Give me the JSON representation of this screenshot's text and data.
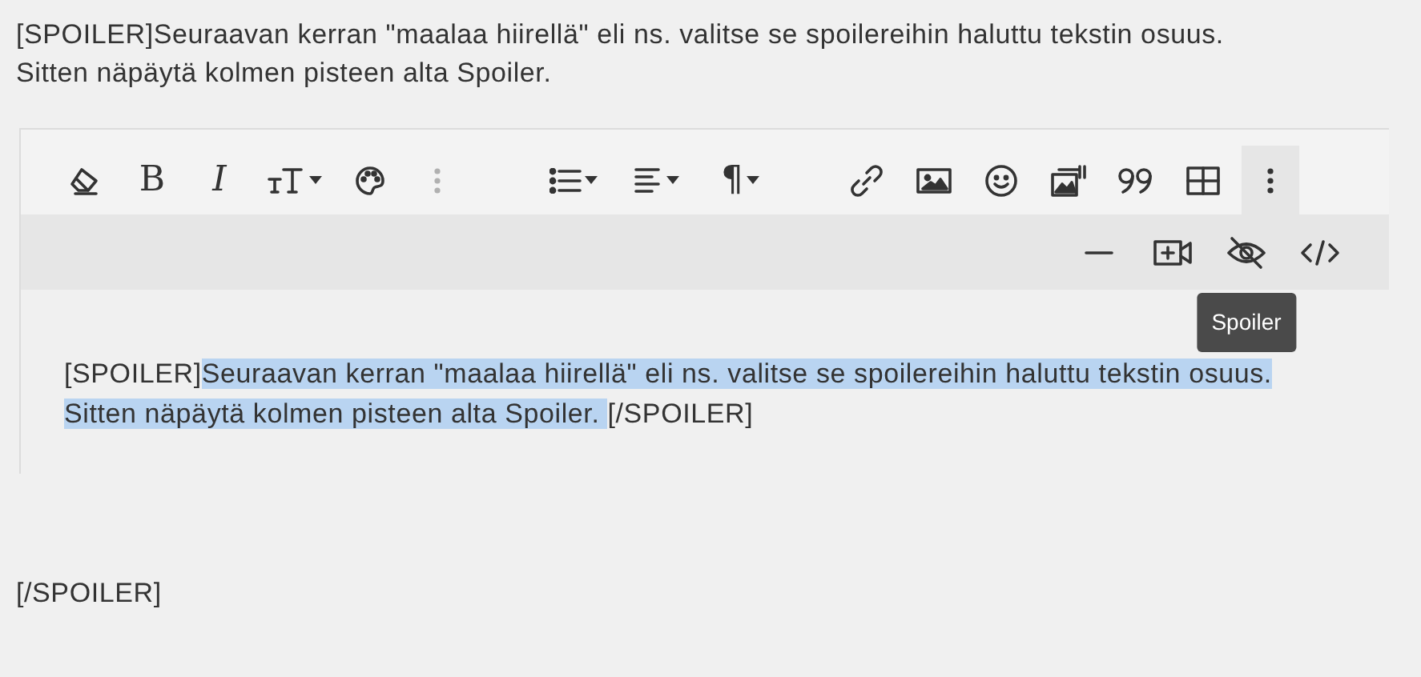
{
  "intro": {
    "lines": [
      "[SPOILER]Seuraavan kerran \"maalaa hiirellä\" eli ns. valitse se spoilereihin haluttu tekstin osuus.",
      "Sitten näpäytä kolmen pisteen alta Spoiler."
    ]
  },
  "editor": {
    "toolbar": {
      "groups": [
        {
          "buttons": [
            {
              "kind": "eraser",
              "caret": false,
              "active": false,
              "disabled": false
            },
            {
              "kind": "bold",
              "glyph": "B",
              "caret": false,
              "active": false,
              "disabled": false
            },
            {
              "kind": "italic",
              "glyph": "I",
              "caret": false,
              "active": false,
              "disabled": false
            },
            {
              "kind": "text-size",
              "caret": true,
              "active": false,
              "disabled": false
            },
            {
              "kind": "palette",
              "caret": false,
              "active": false,
              "disabled": false
            },
            {
              "kind": "dots",
              "caret": false,
              "active": false,
              "disabled": true
            }
          ]
        },
        {
          "buttons": [
            {
              "kind": "list",
              "caret": true,
              "active": false,
              "disabled": false
            },
            {
              "kind": "align",
              "caret": true,
              "active": false,
              "disabled": false
            },
            {
              "kind": "paragraph",
              "glyph": "¶",
              "caret": true,
              "active": false,
              "disabled": false
            }
          ]
        },
        {
          "buttons": [
            {
              "kind": "link",
              "caret": false,
              "active": false,
              "disabled": false
            },
            {
              "kind": "image",
              "caret": false,
              "active": false,
              "disabled": false
            },
            {
              "kind": "smiley",
              "caret": false,
              "active": false,
              "disabled": false
            },
            {
              "kind": "gallery",
              "caret": false,
              "active": false,
              "disabled": false
            },
            {
              "kind": "quote",
              "caret": false,
              "active": false,
              "disabled": false
            },
            {
              "kind": "table",
              "caret": false,
              "active": false,
              "disabled": false
            },
            {
              "kind": "dots",
              "caret": false,
              "active": true,
              "disabled": false
            }
          ]
        }
      ],
      "more_row": [
        {
          "kind": "minus"
        },
        {
          "kind": "video"
        },
        {
          "kind": "eye-slash",
          "tooltip": "Spoiler"
        },
        {
          "kind": "code"
        }
      ]
    },
    "content": {
      "lines": [
        [
          {
            "text": "[SPOILER]",
            "selected": false
          },
          {
            "text": "Seuraavan kerran \"maalaa hiirellä\" eli ns. valitse se spoilereihin haluttu tekstin osuus.",
            "selected": true
          }
        ],
        [
          {
            "text": "Sitten näpäytä kolmen pisteen alta Spoiler. ",
            "selected": true
          },
          {
            "text": "[/SPOILER]",
            "selected": false
          }
        ]
      ]
    }
  },
  "outro": {
    "text": "[/SPOILER]"
  }
}
